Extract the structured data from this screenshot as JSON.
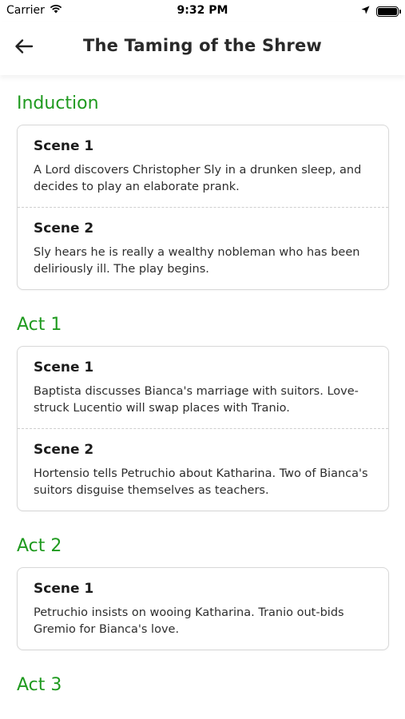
{
  "status_bar": {
    "carrier": "Carrier",
    "time": "9:32 PM",
    "icons": [
      "wifi-icon",
      "location-arrow-icon",
      "battery-icon"
    ]
  },
  "nav": {
    "back_icon": "back-arrow-icon",
    "title": "The Taming of the Shrew"
  },
  "colors": {
    "accent": "#1f9a1f",
    "card_border": "#d8d8d8",
    "text": "#1f1f1f"
  },
  "sections": [
    {
      "title": "Induction",
      "scenes": [
        {
          "title": "Scene 1",
          "description": "A Lord discovers Christopher Sly in a drunken sleep, and decides to play an elaborate prank."
        },
        {
          "title": "Scene 2",
          "description": "Sly hears he is really a wealthy nobleman who has been deliriously ill. The play begins."
        }
      ]
    },
    {
      "title": "Act 1",
      "scenes": [
        {
          "title": "Scene 1",
          "description": "Baptista discusses Bianca's marriage with suitors. Love-struck Lucentio will swap places with Tranio."
        },
        {
          "title": "Scene 2",
          "description": "Hortensio tells Petruchio about Katharina. Two of Bianca's suitors disguise themselves as teachers."
        }
      ]
    },
    {
      "title": "Act 2",
      "scenes": [
        {
          "title": "Scene 1",
          "description": "Petruchio insists on wooing Katharina. Tranio out-bids Gremio for Bianca's love."
        }
      ]
    },
    {
      "title": "Act 3",
      "scenes": []
    }
  ]
}
